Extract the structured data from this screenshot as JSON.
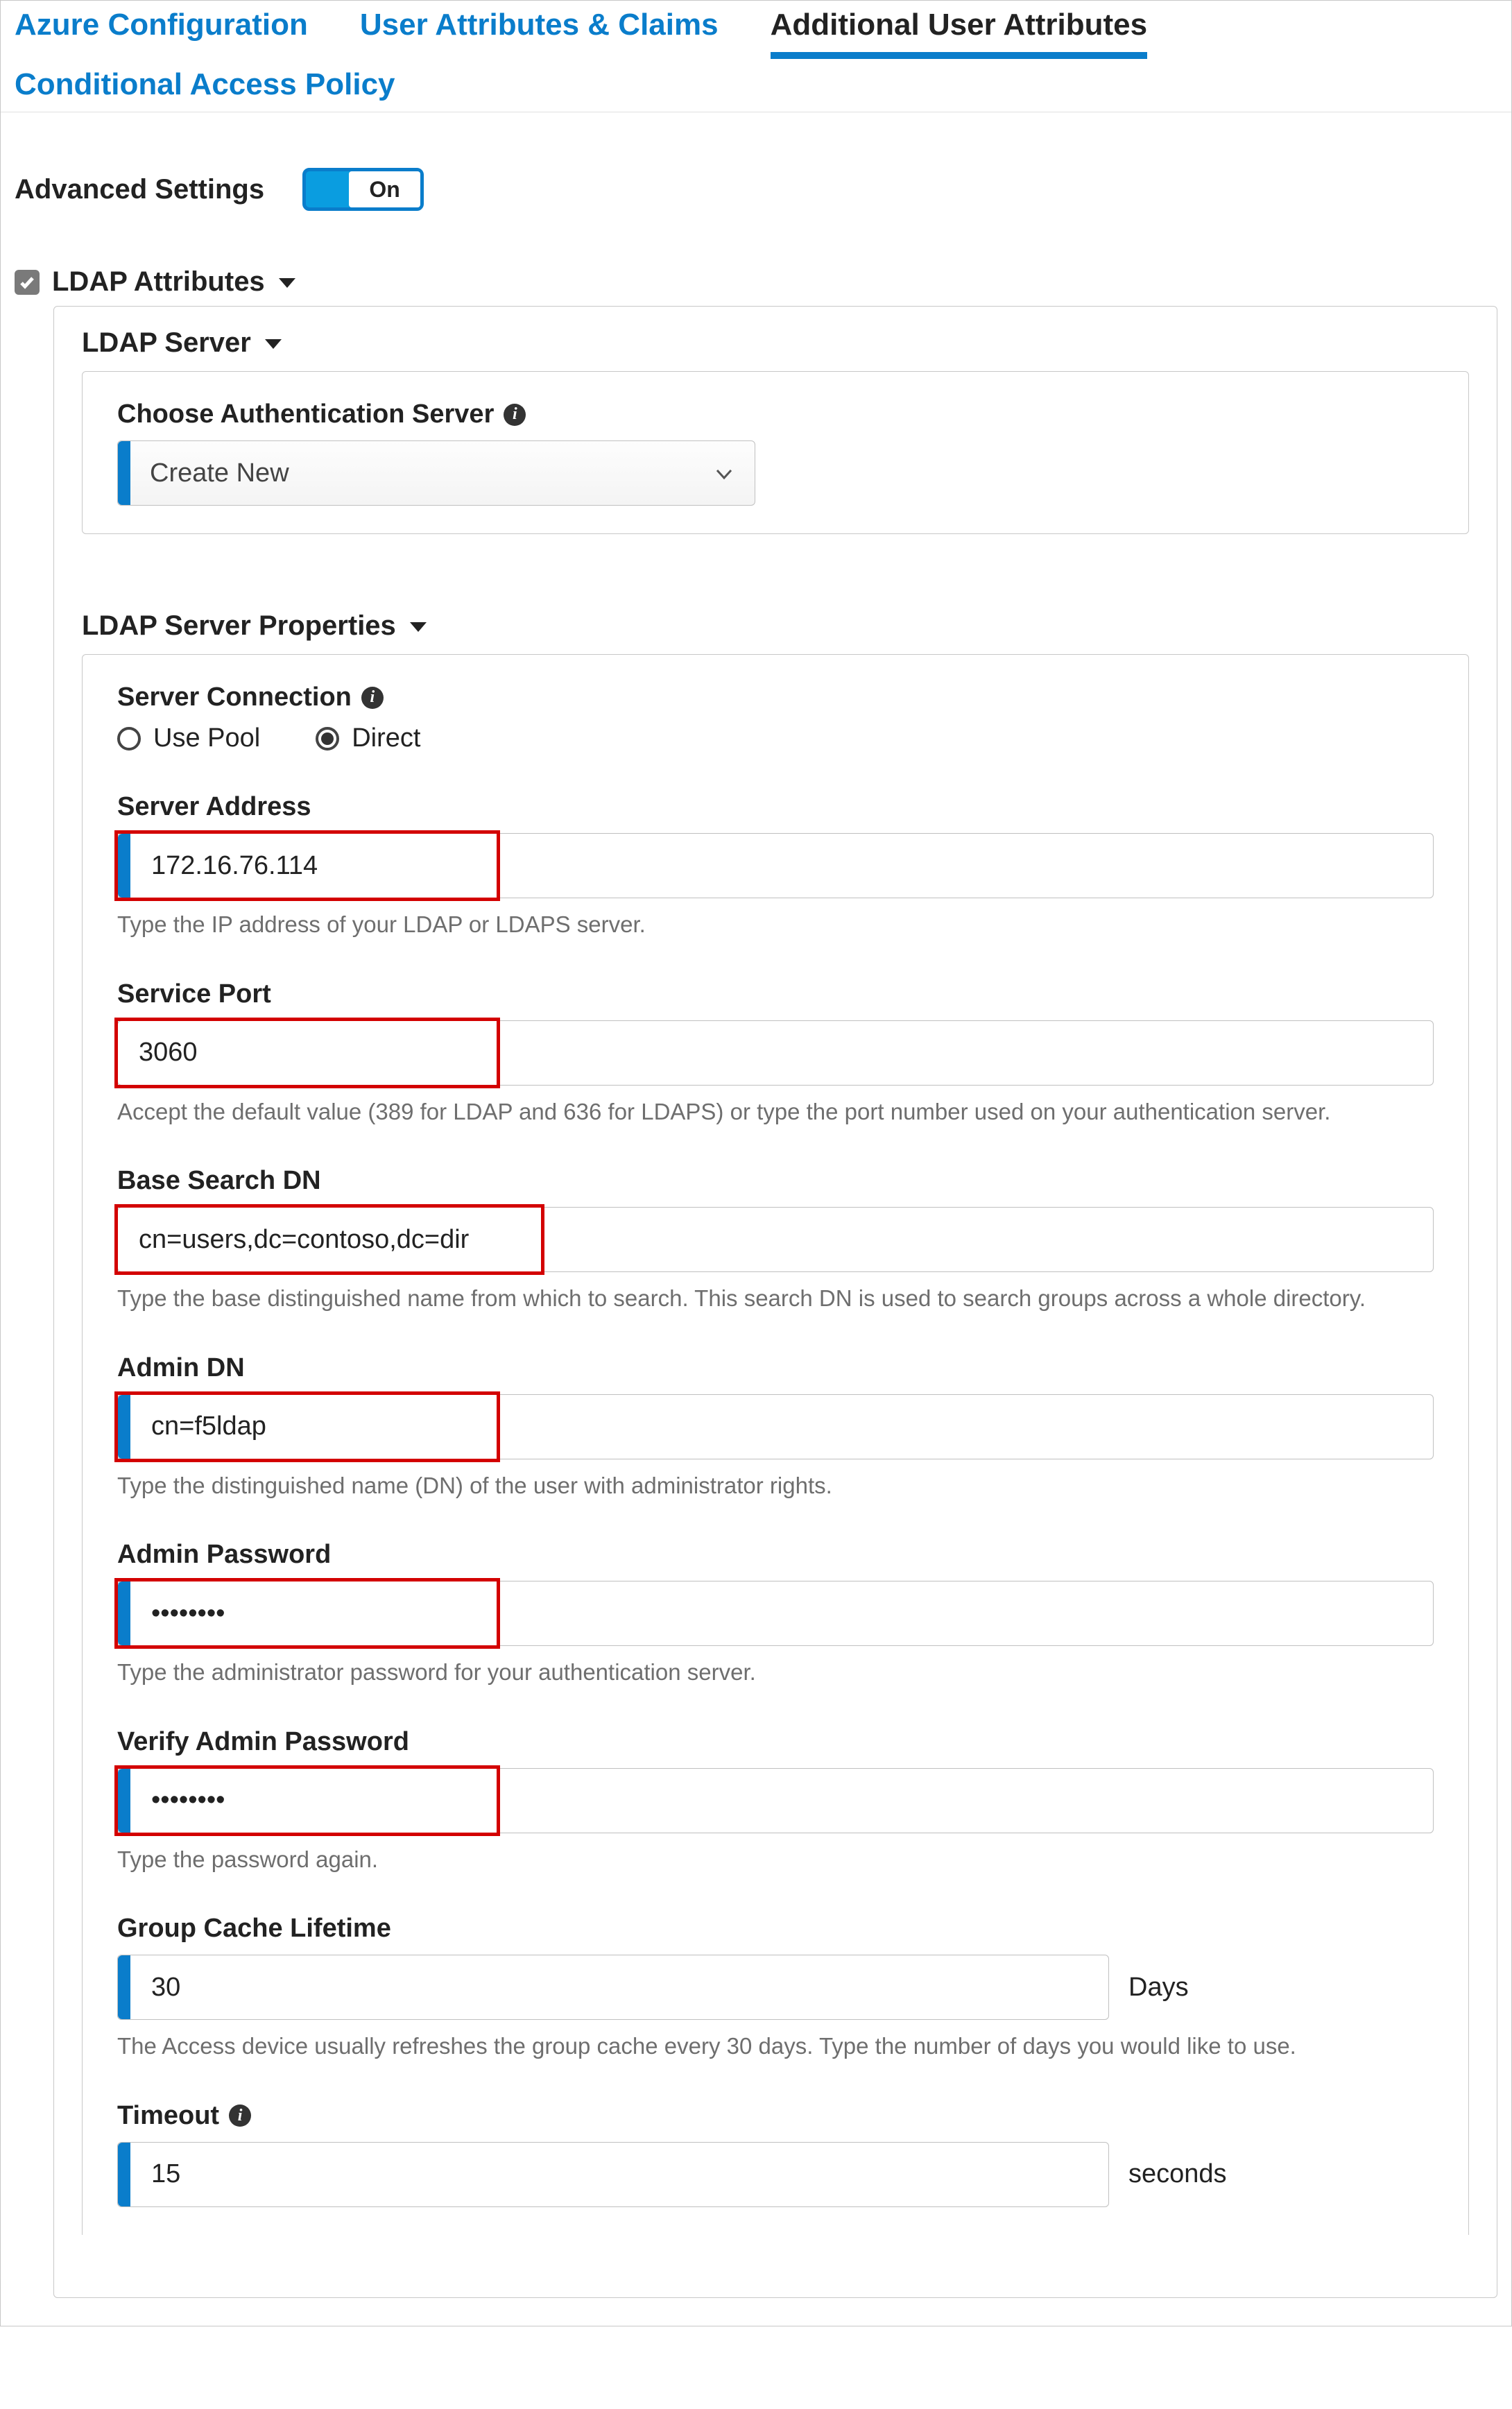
{
  "tabs": {
    "azure": "Azure Configuration",
    "claims": "User Attributes & Claims",
    "additional": "Additional User Attributes",
    "conditional": "Conditional Access Policy"
  },
  "advanced": {
    "label": "Advanced Settings",
    "state": "On"
  },
  "ldap_section": {
    "title": "LDAP Attributes"
  },
  "ldap_server": {
    "title": "LDAP Server",
    "choose_label": "Choose Authentication Server",
    "select_value": "Create New"
  },
  "ldap_props": {
    "title": "LDAP Server Properties",
    "server_connection": {
      "label": "Server Connection",
      "opt_pool": "Use Pool",
      "opt_direct": "Direct"
    },
    "server_address": {
      "label": "Server Address",
      "value": "172.16.76.114",
      "help": "Type the IP address of your LDAP or LDAPS server."
    },
    "service_port": {
      "label": "Service Port",
      "value": "3060",
      "help": "Accept the default value (389 for LDAP and 636 for LDAPS) or type the port number used on your authentication server."
    },
    "base_dn": {
      "label": "Base Search DN",
      "value": "cn=users,dc=contoso,dc=dir",
      "help": "Type the base distinguished name from which to search. This search DN is used to search groups across a whole directory."
    },
    "admin_dn": {
      "label": "Admin DN",
      "value": "cn=f5ldap",
      "help": "Type the distinguished name (DN) of the user with administrator rights."
    },
    "admin_pw": {
      "label": "Admin Password",
      "value": "••••••••",
      "help": "Type the administrator password for your authentication server."
    },
    "verify_pw": {
      "label": "Verify Admin Password",
      "value": "••••••••",
      "help": "Type the password again."
    },
    "group_cache": {
      "label": "Group Cache Lifetime",
      "value": "30",
      "unit": "Days",
      "help": "The Access device usually refreshes the group cache every 30 days. Type the number of days you would like to use."
    },
    "timeout": {
      "label": "Timeout",
      "value": "15",
      "unit": "seconds"
    }
  }
}
